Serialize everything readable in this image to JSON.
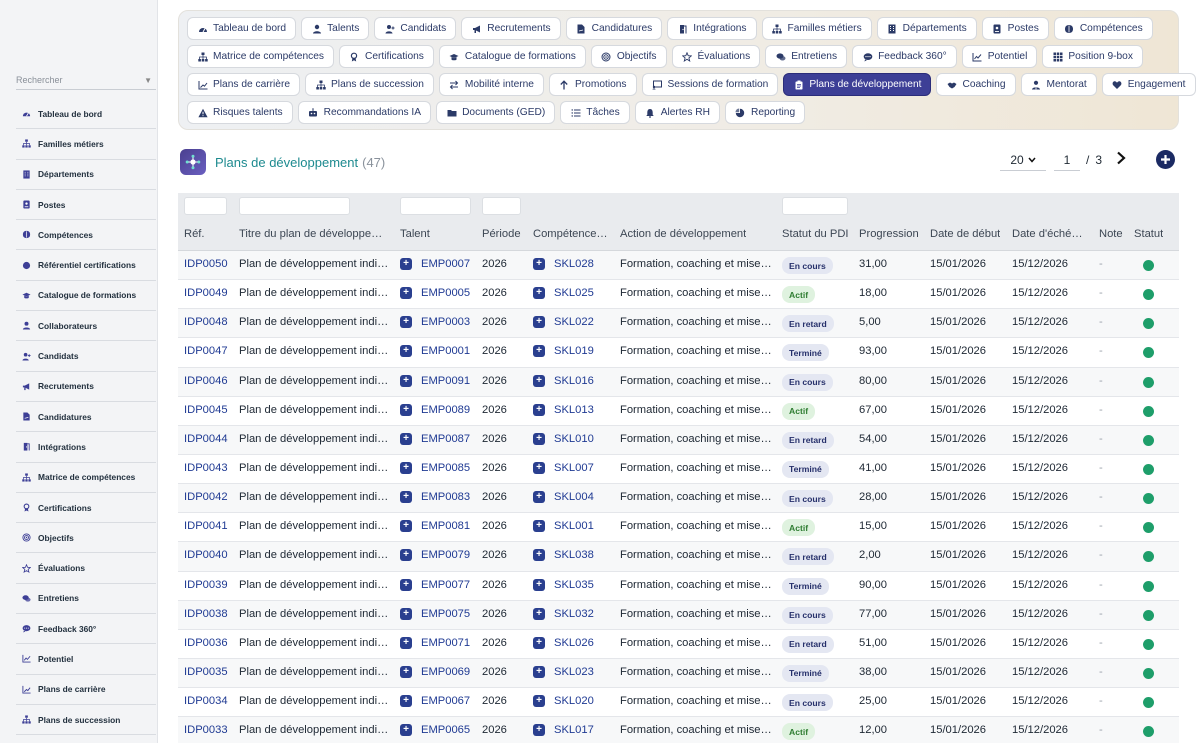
{
  "sidebar": {
    "search_placeholder": "Rechercher",
    "items": [
      {
        "label": "Tableau de bord",
        "icon": "dashboard-icon"
      },
      {
        "label": "Familles métiers",
        "icon": "sitemap-icon"
      },
      {
        "label": "Départements",
        "icon": "building-icon"
      },
      {
        "label": "Postes",
        "icon": "id-badge-icon"
      },
      {
        "label": "Compétences",
        "icon": "brain-icon"
      },
      {
        "label": "Référentiel certifications",
        "icon": "circle-icon"
      },
      {
        "label": "Catalogue de formations",
        "icon": "graduation-cap-icon"
      },
      {
        "label": "Collaborateurs",
        "icon": "user-icon"
      },
      {
        "label": "Candidats",
        "icon": "user-plus-icon"
      },
      {
        "label": "Recrutements",
        "icon": "bullhorn-icon"
      },
      {
        "label": "Candidatures",
        "icon": "file-signature-icon"
      },
      {
        "label": "Intégrations",
        "icon": "door-open-icon"
      },
      {
        "label": "Matrice de compétences",
        "icon": "sitemap-icon"
      },
      {
        "label": "Certifications",
        "icon": "award-icon"
      },
      {
        "label": "Objectifs",
        "icon": "target-icon"
      },
      {
        "label": "Évaluations",
        "icon": "star-icon"
      },
      {
        "label": "Entretiens",
        "icon": "comments-icon"
      },
      {
        "label": "Feedback 360°",
        "icon": "comment-dots-icon"
      },
      {
        "label": "Potentiel",
        "icon": "chart-line-icon"
      },
      {
        "label": "Plans de carrière",
        "icon": "route-icon"
      },
      {
        "label": "Plans de succession",
        "icon": "sitemap-icon"
      }
    ]
  },
  "nav_chips": [
    [
      {
        "label": "Tableau de bord",
        "icon": "dashboard-icon"
      },
      {
        "label": "Talents",
        "icon": "user-icon"
      },
      {
        "label": "Candidats",
        "icon": "user-plus-icon"
      },
      {
        "label": "Recrutements",
        "icon": "bullhorn-icon"
      },
      {
        "label": "Candidatures",
        "icon": "file-signature-icon"
      },
      {
        "label": "Intégrations",
        "icon": "door-open-icon"
      },
      {
        "label": "Familles métiers",
        "icon": "sitemap-icon"
      },
      {
        "label": "Départements",
        "icon": "building-icon"
      },
      {
        "label": "Postes",
        "icon": "id-badge-icon"
      },
      {
        "label": "Compétences",
        "icon": "brain-icon"
      }
    ],
    [
      {
        "label": "Matrice de compétences",
        "icon": "sitemap-icon"
      },
      {
        "label": "Certifications",
        "icon": "award-icon"
      },
      {
        "label": "Catalogue de formations",
        "icon": "graduation-cap-icon"
      },
      {
        "label": "Objectifs",
        "icon": "target-icon"
      },
      {
        "label": "Évaluations",
        "icon": "star-icon"
      },
      {
        "label": "Entretiens",
        "icon": "comments-icon"
      },
      {
        "label": "Feedback 360°",
        "icon": "comment-dots-icon"
      },
      {
        "label": "Potentiel",
        "icon": "chart-line-icon"
      },
      {
        "label": "Position 9-box",
        "icon": "grid-icon"
      }
    ],
    [
      {
        "label": "Plans de carrière",
        "icon": "route-icon"
      },
      {
        "label": "Plans de succession",
        "icon": "sitemap-icon"
      },
      {
        "label": "Mobilité interne",
        "icon": "exchange-icon"
      },
      {
        "label": "Promotions",
        "icon": "arrow-up-icon"
      },
      {
        "label": "Sessions de formation",
        "icon": "chalkboard-icon"
      },
      {
        "label": "Plans de développement",
        "icon": "clipboard-icon",
        "active": true
      },
      {
        "label": "Coaching",
        "icon": "handshake-icon"
      },
      {
        "label": "Mentorat",
        "icon": "user-tie-icon"
      },
      {
        "label": "Engagement",
        "icon": "heart-icon"
      }
    ],
    [
      {
        "label": "Risques talents",
        "icon": "warning-icon"
      },
      {
        "label": "Recommandations IA",
        "icon": "robot-icon"
      },
      {
        "label": "Documents (GED)",
        "icon": "folder-icon"
      },
      {
        "label": "Tâches",
        "icon": "list-icon"
      },
      {
        "label": "Alertes RH",
        "icon": "bell-icon"
      },
      {
        "label": "Reporting",
        "icon": "pie-chart-icon"
      }
    ]
  ],
  "header": {
    "title": "Plans de développement",
    "count": "(47)",
    "per_page": "20",
    "page": "1",
    "page_sep": "/",
    "page_total": "3",
    "next_icon": "chevron-right-icon",
    "add_icon": "plus-circle-icon"
  },
  "table": {
    "columns": [
      "Réf.",
      "Titre du plan de développe…",
      "Talent",
      "Période",
      "Compétence…",
      "Action de développement",
      "Statut du PDI",
      "Progression",
      "Date de début",
      "Date d'éché…",
      "Note",
      "Statut"
    ],
    "rows": [
      {
        "ref": "IDP0050",
        "titre": "Plan de développement indi…",
        "talent": "EMP0007",
        "periode": "2026",
        "competence": "SKL028",
        "action": "Formation, coaching et mise…",
        "statut_pdi": "En cours",
        "progression": "31,00",
        "debut": "15/01/2026",
        "echeance": "15/12/2026",
        "note": "-"
      },
      {
        "ref": "IDP0049",
        "titre": "Plan de développement indi…",
        "talent": "EMP0005",
        "periode": "2026",
        "competence": "SKL025",
        "action": "Formation, coaching et mise…",
        "statut_pdi": "Actif",
        "progression": "18,00",
        "debut": "15/01/2026",
        "echeance": "15/12/2026",
        "note": "-"
      },
      {
        "ref": "IDP0048",
        "titre": "Plan de développement indi…",
        "talent": "EMP0003",
        "periode": "2026",
        "competence": "SKL022",
        "action": "Formation, coaching et mise…",
        "statut_pdi": "En retard",
        "progression": "5,00",
        "debut": "15/01/2026",
        "echeance": "15/12/2026",
        "note": "-"
      },
      {
        "ref": "IDP0047",
        "titre": "Plan de développement indi…",
        "talent": "EMP0001",
        "periode": "2026",
        "competence": "SKL019",
        "action": "Formation, coaching et mise…",
        "statut_pdi": "Terminé",
        "progression": "93,00",
        "debut": "15/01/2026",
        "echeance": "15/12/2026",
        "note": "-"
      },
      {
        "ref": "IDP0046",
        "titre": "Plan de développement indi…",
        "talent": "EMP0091",
        "periode": "2026",
        "competence": "SKL016",
        "action": "Formation, coaching et mise…",
        "statut_pdi": "En cours",
        "progression": "80,00",
        "debut": "15/01/2026",
        "echeance": "15/12/2026",
        "note": "-"
      },
      {
        "ref": "IDP0045",
        "titre": "Plan de développement indi…",
        "talent": "EMP0089",
        "periode": "2026",
        "competence": "SKL013",
        "action": "Formation, coaching et mise…",
        "statut_pdi": "Actif",
        "progression": "67,00",
        "debut": "15/01/2026",
        "echeance": "15/12/2026",
        "note": "-"
      },
      {
        "ref": "IDP0044",
        "titre": "Plan de développement indi…",
        "talent": "EMP0087",
        "periode": "2026",
        "competence": "SKL010",
        "action": "Formation, coaching et mise…",
        "statut_pdi": "En retard",
        "progression": "54,00",
        "debut": "15/01/2026",
        "echeance": "15/12/2026",
        "note": "-"
      },
      {
        "ref": "IDP0043",
        "titre": "Plan de développement indi…",
        "talent": "EMP0085",
        "periode": "2026",
        "competence": "SKL007",
        "action": "Formation, coaching et mise…",
        "statut_pdi": "Terminé",
        "progression": "41,00",
        "debut": "15/01/2026",
        "echeance": "15/12/2026",
        "note": "-"
      },
      {
        "ref": "IDP0042",
        "titre": "Plan de développement indi…",
        "talent": "EMP0083",
        "periode": "2026",
        "competence": "SKL004",
        "action": "Formation, coaching et mise…",
        "statut_pdi": "En cours",
        "progression": "28,00",
        "debut": "15/01/2026",
        "echeance": "15/12/2026",
        "note": "-"
      },
      {
        "ref": "IDP0041",
        "titre": "Plan de développement indi…",
        "talent": "EMP0081",
        "periode": "2026",
        "competence": "SKL001",
        "action": "Formation, coaching et mise…",
        "statut_pdi": "Actif",
        "progression": "15,00",
        "debut": "15/01/2026",
        "echeance": "15/12/2026",
        "note": "-"
      },
      {
        "ref": "IDP0040",
        "titre": "Plan de développement indi…",
        "talent": "EMP0079",
        "periode": "2026",
        "competence": "SKL038",
        "action": "Formation, coaching et mise…",
        "statut_pdi": "En retard",
        "progression": "2,00",
        "debut": "15/01/2026",
        "echeance": "15/12/2026",
        "note": "-"
      },
      {
        "ref": "IDP0039",
        "titre": "Plan de développement indi…",
        "talent": "EMP0077",
        "periode": "2026",
        "competence": "SKL035",
        "action": "Formation, coaching et mise…",
        "statut_pdi": "Terminé",
        "progression": "90,00",
        "debut": "15/01/2026",
        "echeance": "15/12/2026",
        "note": "-"
      },
      {
        "ref": "IDP0038",
        "titre": "Plan de développement indi…",
        "talent": "EMP0075",
        "periode": "2026",
        "competence": "SKL032",
        "action": "Formation, coaching et mise…",
        "statut_pdi": "En cours",
        "progression": "77,00",
        "debut": "15/01/2026",
        "echeance": "15/12/2026",
        "note": "-"
      },
      {
        "ref": "IDP0036",
        "titre": "Plan de développement indi…",
        "talent": "EMP0071",
        "periode": "2026",
        "competence": "SKL026",
        "action": "Formation, coaching et mise…",
        "statut_pdi": "En retard",
        "progression": "51,00",
        "debut": "15/01/2026",
        "echeance": "15/12/2026",
        "note": "-"
      },
      {
        "ref": "IDP0035",
        "titre": "Plan de développement indi…",
        "talent": "EMP0069",
        "periode": "2026",
        "competence": "SKL023",
        "action": "Formation, coaching et mise…",
        "statut_pdi": "Terminé",
        "progression": "38,00",
        "debut": "15/01/2026",
        "echeance": "15/12/2026",
        "note": "-"
      },
      {
        "ref": "IDP0034",
        "titre": "Plan de développement indi…",
        "talent": "EMP0067",
        "periode": "2026",
        "competence": "SKL020",
        "action": "Formation, coaching et mise…",
        "statut_pdi": "En cours",
        "progression": "25,00",
        "debut": "15/01/2026",
        "echeance": "15/12/2026",
        "note": "-"
      },
      {
        "ref": "IDP0033",
        "titre": "Plan de développement indi…",
        "talent": "EMP0065",
        "periode": "2026",
        "competence": "SKL017",
        "action": "Formation, coaching et mise…",
        "statut_pdi": "Actif",
        "progression": "12,00",
        "debut": "15/01/2026",
        "echeance": "15/12/2026",
        "note": "-"
      }
    ]
  },
  "colors": {
    "accent": "#3d3f96",
    "title": "#1d8a8f",
    "link": "#1f3a93",
    "status_dot": "#1e9e6a"
  }
}
